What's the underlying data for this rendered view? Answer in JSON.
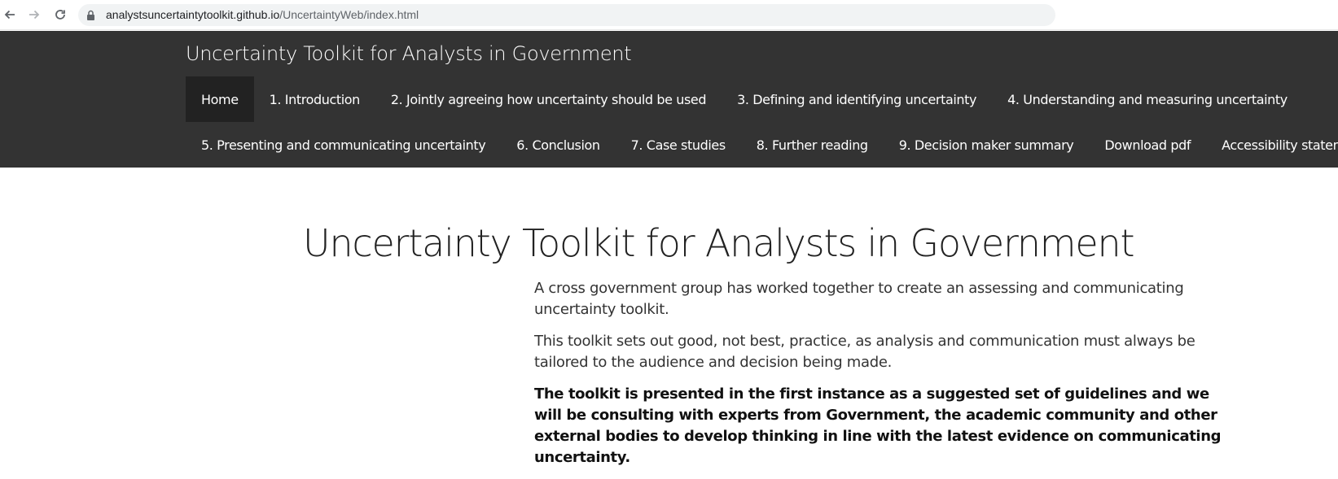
{
  "browser": {
    "url_host": "analystsuncertaintytoolkit.github.io",
    "url_path": "/UncertaintyWeb/index.html"
  },
  "site": {
    "brand": "Uncertainty Toolkit for Analysts in Government",
    "menu_row1": [
      {
        "label": "Home",
        "active": true
      },
      {
        "label": "1. Introduction"
      },
      {
        "label": "2. Jointly agreeing how uncertainty should be used"
      },
      {
        "label": "3. Defining and identifying uncertainty"
      },
      {
        "label": "4. Understanding and measuring uncertainty"
      }
    ],
    "menu_row2": [
      {
        "label": "5. Presenting and communicating uncertainty"
      },
      {
        "label": "6. Conclusion"
      },
      {
        "label": "7. Case studies"
      },
      {
        "label": "8. Further reading"
      },
      {
        "label": "9. Decision maker summary"
      },
      {
        "label": "Download pdf"
      },
      {
        "label": "Accessibility statement"
      }
    ]
  },
  "main": {
    "title": "Uncertainty Toolkit for Analysts in Government",
    "paragraphs": [
      "A cross government group has worked together to create an assessing and communicating uncertainty toolkit.",
      "This toolkit sets out good, not best, practice, as analysis and communication must always be tailored to the audience and decision being made.",
      "The toolkit is presented in the first instance as a suggested set of guidelines and we will be consulting with experts from Government, the academic community and other external bodies to develop thinking in line with the latest evidence on communicating uncertainty."
    ]
  },
  "colors": {
    "navbar_bg": "#333333",
    "active_item_bg": "#222222"
  }
}
